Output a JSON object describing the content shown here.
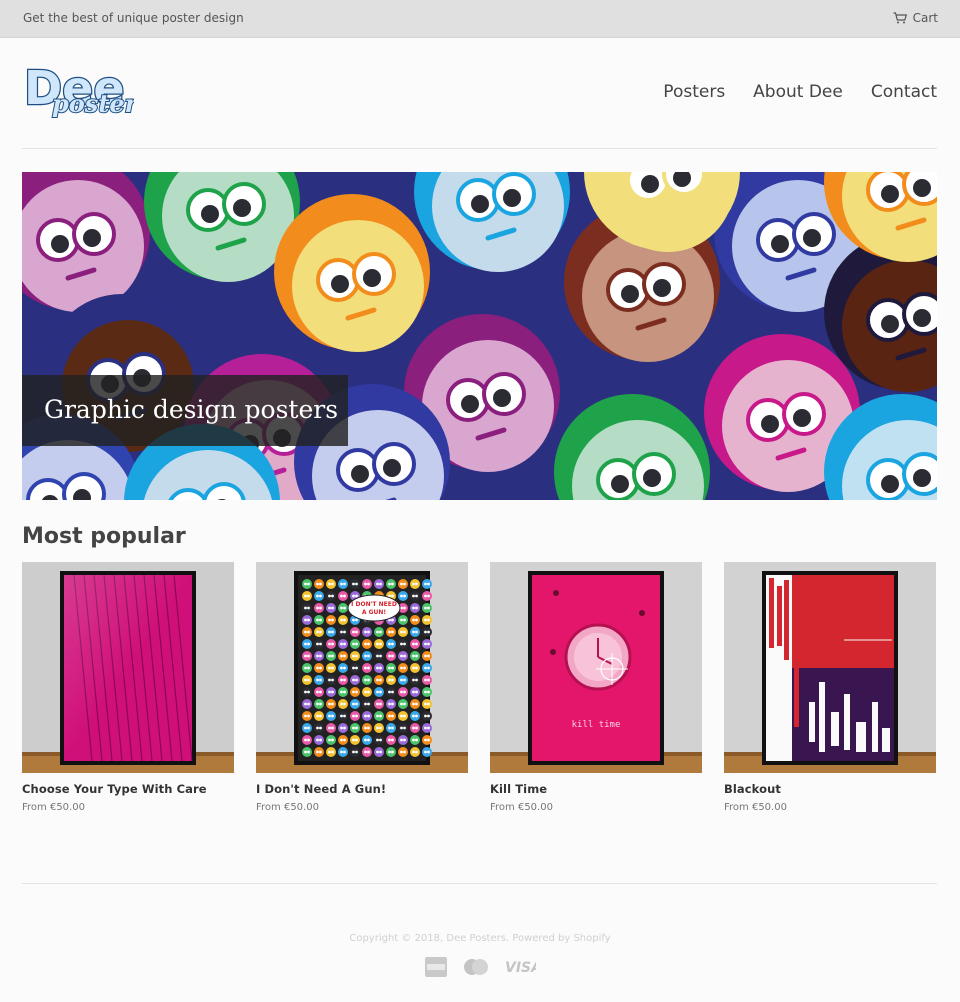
{
  "announcement": {
    "message": "Get the best of unique poster design",
    "cart_label": "Cart"
  },
  "brand": {
    "logo_line1": "Dee",
    "logo_line2": "posters"
  },
  "nav": {
    "items": [
      "Posters",
      "About Dee",
      "Contact"
    ]
  },
  "hero": {
    "caption": "Graphic design posters"
  },
  "section": {
    "title": "Most popular"
  },
  "products": [
    {
      "title": "Choose Your Type With Care",
      "price": "From €50.00"
    },
    {
      "title": "I Don't Need A Gun!",
      "price": "From €50.00",
      "speech": [
        "I DON'T NEED",
        "A GUN!"
      ]
    },
    {
      "title": "Kill Time",
      "price": "From €50.00",
      "poster_text": "kill time"
    },
    {
      "title": "Blackout",
      "price": "From €50.00"
    }
  ],
  "footer": {
    "copyright": "Copyright © 2018, Dee Posters. Powered by Shopify",
    "payment_icons": [
      "american-express-icon",
      "master-card-icon",
      "visa-icon"
    ],
    "visa_label": "VISA"
  },
  "colors": {
    "announcement_bg": "#e0e0e0",
    "logo_blue": "#1f6fb8",
    "hero_caption_bg": "#222222",
    "poster_pink": "#e0106c",
    "poster_red": "#d3262e",
    "poster_purple": "#3a1650"
  }
}
